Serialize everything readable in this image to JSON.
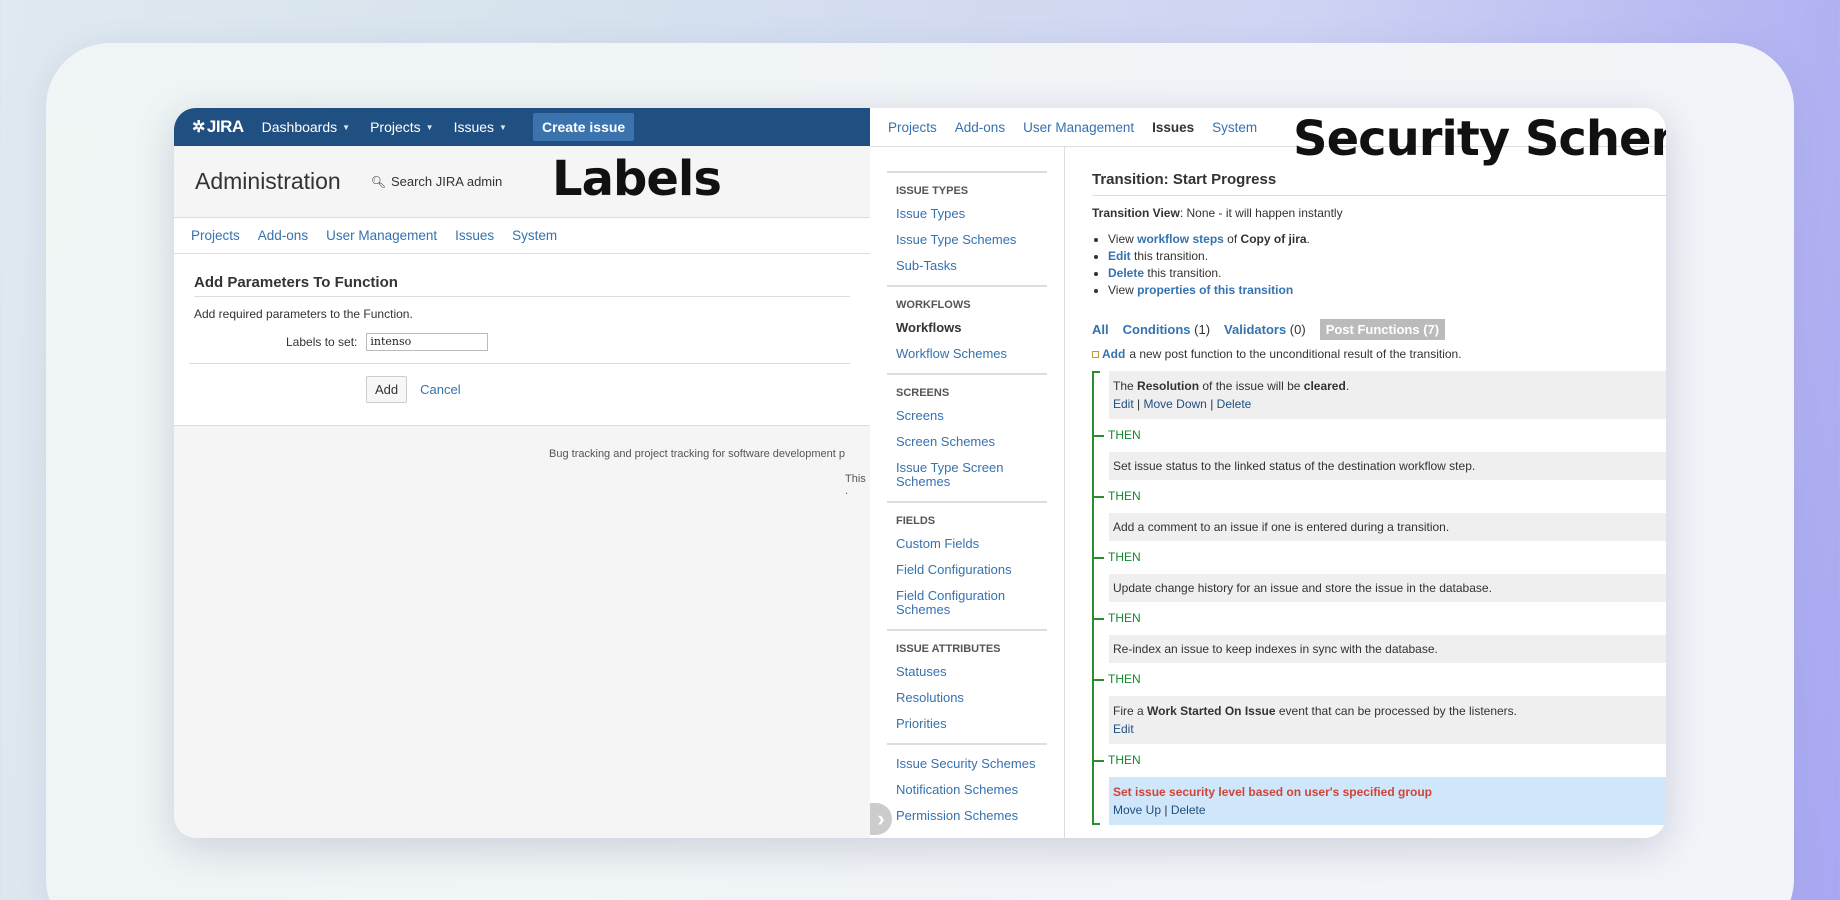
{
  "left": {
    "logo": "JIRA",
    "nav": [
      "Dashboards",
      "Projects",
      "Issues"
    ],
    "create_label": "Create issue",
    "admin_title": "Administration",
    "admin_search": "Search JIRA admin",
    "overlay_label": "Labels",
    "subnav": [
      "Projects",
      "Add-ons",
      "User Management",
      "Issues",
      "System"
    ],
    "section_title": "Add Parameters To Function",
    "description": "Add required parameters to the Function.",
    "field_label": "Labels to set:",
    "field_value": "intenso",
    "add_label": "Add",
    "cancel_label": "Cancel",
    "footer1": "Bug tracking and project tracking for software development p",
    "footer2": "This ."
  },
  "right": {
    "topnav": [
      "Projects",
      "Add-ons",
      "User Management",
      "Issues",
      "System"
    ],
    "overlay_label": "Security Scheme",
    "sidebar": [
      {
        "title": "ISSUE TYPES",
        "items": [
          "Issue Types",
          "Issue Type Schemes",
          "Sub-Tasks"
        ]
      },
      {
        "title": "WORKFLOWS",
        "items": [
          "Workflows",
          "Workflow Schemes"
        ]
      },
      {
        "title": "SCREENS",
        "items": [
          "Screens",
          "Screen Schemes",
          "Issue Type Screen Schemes"
        ]
      },
      {
        "title": "FIELDS",
        "items": [
          "Custom Fields",
          "Field Configurations",
          "Field Configuration Schemes"
        ]
      },
      {
        "title": "ISSUE ATTRIBUTES",
        "items": [
          "Statuses",
          "Resolutions",
          "Priorities"
        ]
      },
      {
        "title": "",
        "items": [
          "Issue Security Schemes",
          "Notification Schemes",
          "Permission Schemes"
        ]
      }
    ],
    "transition_title": "Transition: Start Progress",
    "transition_view_label": "Transition View",
    "transition_view_value": ": None - it will happen instantly",
    "bullets": {
      "b1_pre": "View",
      "b1_link": "workflow steps",
      "b1_mid": "of",
      "b1_bold": "Copy of jira",
      "b1_post": ".",
      "b2_link": "Edit",
      "b2_post": "this transition.",
      "b3_link": "Delete",
      "b3_post": "this transition.",
      "b4_pre": "View",
      "b4_link": "properties of this transition"
    },
    "tabs": {
      "all": "All",
      "conditions": "Conditions",
      "conditions_count": "(1)",
      "validators": "Validators",
      "validators_count": "(0)",
      "post_functions": "Post Functions",
      "post_functions_count": "(7)"
    },
    "add_link": "Add",
    "add_text": "a new post function to the unconditional result of the transition.",
    "then_label": "THEN",
    "pf1": {
      "pre": "The",
      "b1": "Resolution",
      "mid": "of the issue will be",
      "b2": "cleared",
      "post": ".",
      "edit": "Edit",
      "sep": "|",
      "move_down": "Move Down",
      "delete": "Delete"
    },
    "pf2": "Set issue status to the linked status of the destination workflow step.",
    "pf3": "Add a comment to an issue if one is entered during a transition.",
    "pf4": "Update change history for an issue and store the issue in the database.",
    "pf5": "Re-index an issue to keep indexes in sync with the database.",
    "pf6": {
      "pre": "Fire a",
      "bold": "Work Started On Issue",
      "post": "event that can be processed by the listeners.",
      "edit": "Edit"
    },
    "pf7": {
      "text": "Set issue security level based on user's specified group",
      "move_up": "Move Up",
      "sep": "|",
      "delete": "Delete"
    }
  }
}
